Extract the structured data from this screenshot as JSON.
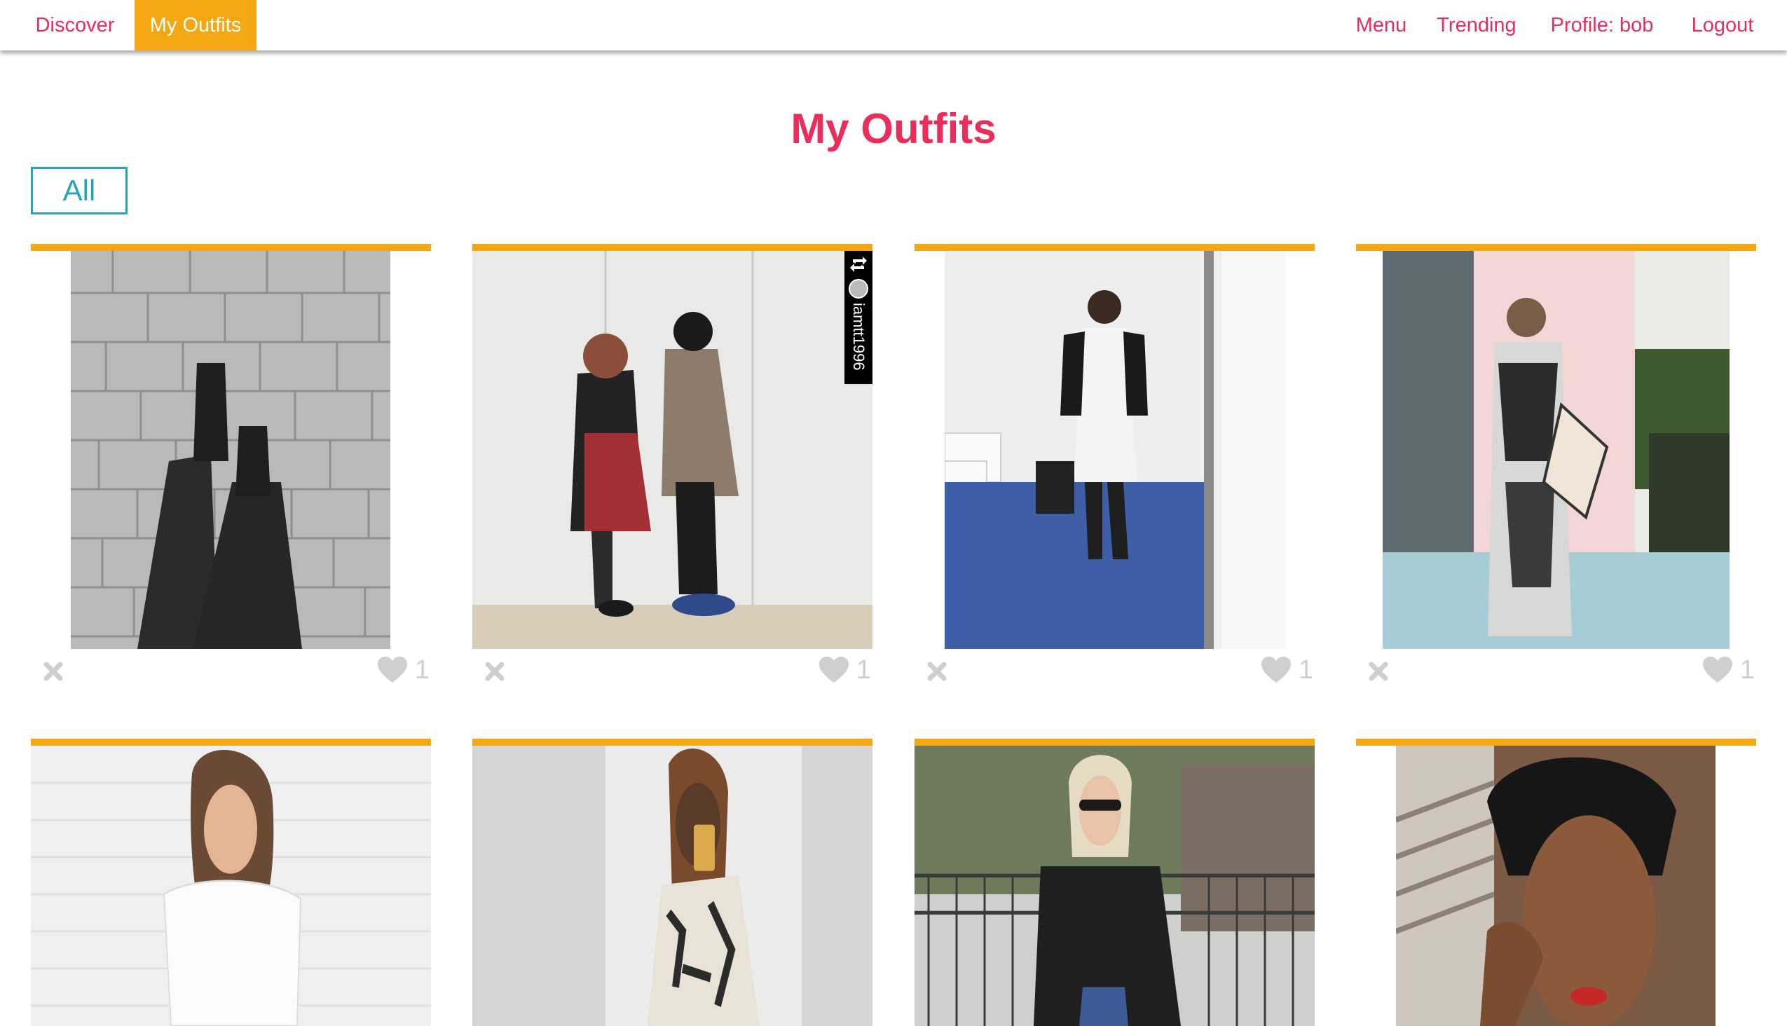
{
  "nav": {
    "left": [
      {
        "label": "Discover",
        "active": false
      },
      {
        "label": "My Outfits",
        "active": true
      }
    ],
    "right": [
      {
        "label": "Menu"
      },
      {
        "label": "Trending"
      },
      {
        "label": "Profile: bob"
      },
      {
        "label": "Logout"
      }
    ]
  },
  "page": {
    "title": "My Outfits",
    "filter_label": "All"
  },
  "outfits": [
    {
      "likes": "1",
      "subject": "leather pants and boots on brick pavement"
    },
    {
      "likes": "1",
      "subject": "couple in leather jackets",
      "watermark": "iamtt1996"
    },
    {
      "likes": "1",
      "subject": "mirror selfie in white coat"
    },
    {
      "likes": "1",
      "subject": "patterned jumpsuit at event"
    },
    {
      "likes": "",
      "subject": "woman in off-shoulder white top"
    },
    {
      "likes": "",
      "subject": "mirror selfie in printed dress"
    },
    {
      "likes": "",
      "subject": "woman in sunglasses and black coat"
    },
    {
      "likes": "",
      "subject": "woman in black head wrap"
    }
  ],
  "colors": {
    "accent_pink": "#ea2e5c",
    "accent_orange": "#f3a712",
    "filter_teal": "#2aa3b8",
    "icon_gray": "#cfcfcf"
  },
  "icons": {
    "remove": "close-icon",
    "like": "heart-icon",
    "repost": "repost-icon"
  }
}
